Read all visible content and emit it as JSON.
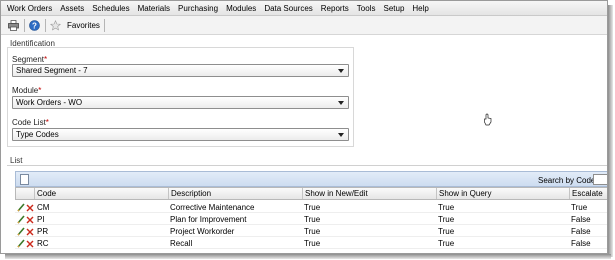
{
  "menu": [
    "Work Orders",
    "Assets",
    "Schedules",
    "Materials",
    "Purchasing",
    "Modules",
    "Data Sources",
    "Reports",
    "Tools",
    "Setup",
    "Help"
  ],
  "toolbar": {
    "print_icon": "printer-icon",
    "help_icon": "help-icon",
    "favorites_icon": "star-icon",
    "favorites_label": "Favorites"
  },
  "identification": {
    "section_label": "Identification",
    "segment": {
      "label": "Segment",
      "required_mark": "*",
      "value": "Shared Segment - 7"
    },
    "module": {
      "label": "Module",
      "required_mark": "*",
      "value": "Work Orders - WO"
    },
    "code_list": {
      "label": "Code List",
      "required_mark": "*",
      "value": "Type Codes"
    }
  },
  "list": {
    "section_label": "List",
    "new_icon": "new-document-icon",
    "search_label": "Search by Code",
    "search_value": "",
    "columns": [
      "Code",
      "Description",
      "Show in New/Edit",
      "Show in Query",
      "Escalate"
    ],
    "rows": [
      {
        "code": "CM",
        "description": "Corrective Maintenance",
        "show_in_new_edit": "True",
        "show_in_query": "True",
        "escalate": "True"
      },
      {
        "code": "PI",
        "description": "Plan for Improvement",
        "show_in_new_edit": "True",
        "show_in_query": "True",
        "escalate": "False"
      },
      {
        "code": "PR",
        "description": "Project Workorder",
        "show_in_new_edit": "True",
        "show_in_query": "True",
        "escalate": "False"
      },
      {
        "code": "RC",
        "description": "Recall",
        "show_in_new_edit": "True",
        "show_in_query": "True",
        "escalate": "False"
      }
    ],
    "row_icons": {
      "edit": "pencil-icon",
      "delete": "delete-x-icon"
    }
  },
  "colors": {
    "grid_toolbar": "#cddcf0",
    "required": "#c00000",
    "delete": "#cc2a1c",
    "edit": "#3a7a2a"
  }
}
